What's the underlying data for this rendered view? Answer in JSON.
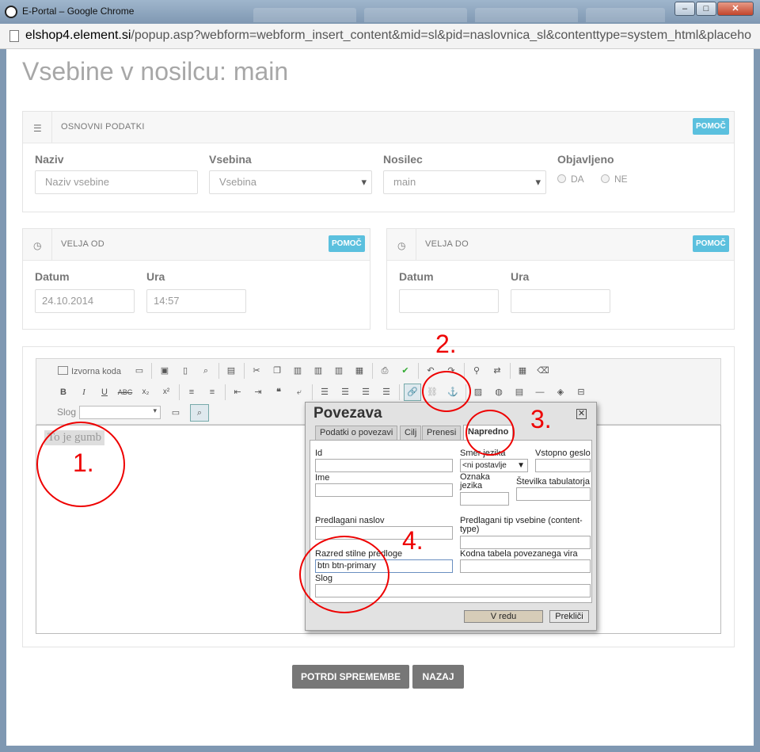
{
  "window": {
    "title": "E-Portal – Google Chrome",
    "url_host": "elshop4.element.si",
    "url_path": "/popup.asp?webform=webform_insert_content&mid=sl&pid=naslovnica_sl&contenttype=system_html&placeho"
  },
  "page": {
    "title": "Vsebine v nosilcu: main"
  },
  "basic": {
    "title": "OSNOVNI PODATKI",
    "help": "POMOČ",
    "naziv_label": "Naziv",
    "naziv_placeholder": "Naziv vsebine",
    "vsebina_label": "Vsebina",
    "vsebina_value": "Vsebina",
    "nosilec_label": "Nosilec",
    "nosilec_value": "main",
    "objavljeno_label": "Objavljeno",
    "opt_da": "DA",
    "opt_ne": "NE"
  },
  "valid_from": {
    "title": "VELJA OD",
    "help": "POMOČ",
    "date_label": "Datum",
    "date_value": "24.10.2014",
    "time_label": "Ura",
    "time_value": "14:57"
  },
  "valid_to": {
    "title": "VELJA DO",
    "help": "POMOČ",
    "date_label": "Datum",
    "time_label": "Ura"
  },
  "editor": {
    "source_label": "Izvorna koda",
    "style_label": "Slog",
    "content": "To je gumb"
  },
  "dialog": {
    "title": "Povezava",
    "close": "☒",
    "tabs": [
      "Podatki o povezavi",
      "Cilj",
      "Prenesi",
      "Napredno"
    ],
    "id_label": "Id",
    "lang_dir_label": "Smer jezika",
    "lang_dir_value": "<ni postavlje",
    "access_key_label": "Vstopno geslo",
    "name_label": "Ime",
    "lang_code_label": "Oznaka jezika",
    "tab_index_label": "Številka tabulatorja",
    "advisory_title_label": "Predlagani naslov",
    "content_type_label": "Predlagani tip vsebine (content-type)",
    "css_class_label": "Razred stilne predloge",
    "css_class_value": "btn btn-primary",
    "charset_label": "Kodna tabela povezanega vira",
    "style_label": "Slog",
    "ok": "V redu",
    "cancel": "Prekliči"
  },
  "annotations": [
    "1.",
    "2.",
    "3.",
    "4."
  ],
  "actions": {
    "confirm": "POTRDI SPREMEMBE",
    "back": "NAZAJ"
  },
  "colors": {
    "help_button": "#5bc0de",
    "action_button": "#777777",
    "annotation": "#e00000"
  }
}
